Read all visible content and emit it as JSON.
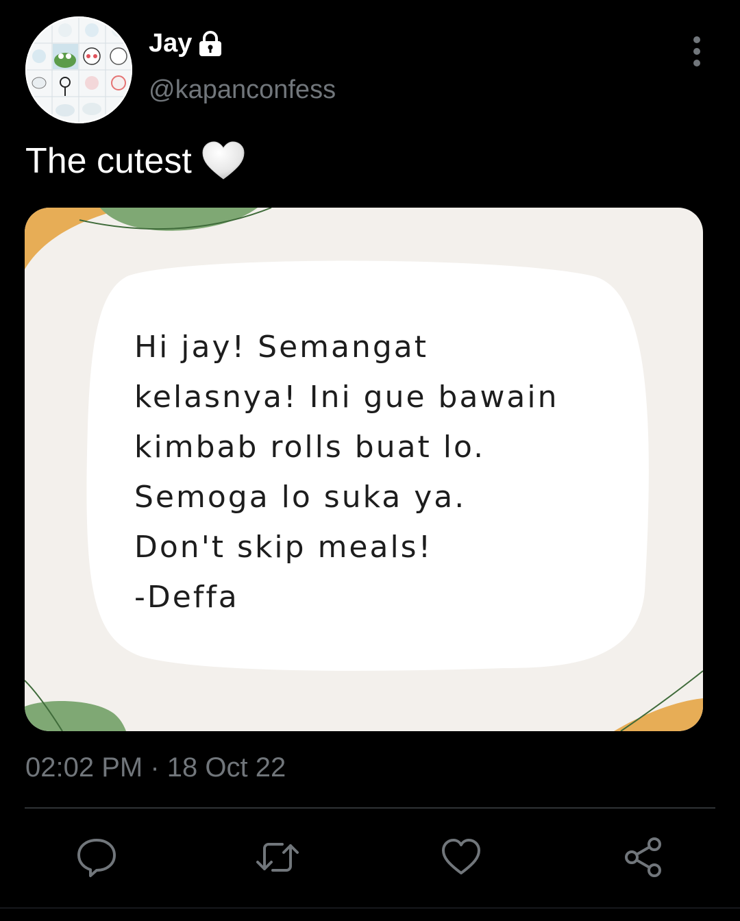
{
  "tweet": {
    "author": {
      "display_name": "Jay",
      "handle": "@kapanconfess",
      "protected_icon": "lock-icon",
      "avatar": "sticker-collage-avatar"
    },
    "text": "The cutest",
    "emoji": "white-heart",
    "menu_icon": "more-vertical-icon",
    "media": {
      "type": "note-image",
      "lines": [
        "Hi jay! Semangat",
        "kelasnya! Ini gue bawain",
        "kimbab rolls buat lo.",
        "Semoga lo suka ya.",
        "Don't skip meals!",
        "-Deffa"
      ],
      "colors": {
        "background": "#f3f0ec",
        "note": "#ffffff",
        "green": "#7fa874",
        "orange": "#e7ad56"
      }
    },
    "timestamp": "02:02 PM · 18 Oct 22",
    "actions": {
      "reply_icon": "reply-icon",
      "retweet_icon": "retweet-icon",
      "like_icon": "heart-icon",
      "share_icon": "share-icon"
    }
  }
}
